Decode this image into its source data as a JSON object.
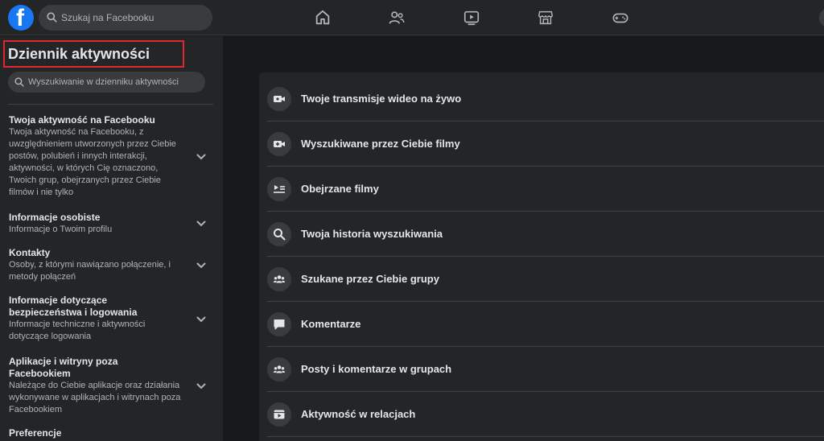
{
  "topbar": {
    "search_placeholder": "Szukaj na Facebooku",
    "nav_icons": [
      "home-icon",
      "friends-icon",
      "watch-icon",
      "marketplace-icon",
      "gaming-icon"
    ]
  },
  "sidebar": {
    "title": "Dziennik aktywności",
    "search_placeholder": "Wyszukiwanie w dzienniku aktywności",
    "items": [
      {
        "heading": "Twoja aktywność na Facebooku",
        "desc_lines": [
          "Twoja aktywność na Facebooku, z",
          "uwzględnieniem utworzonych przez Ciebie",
          "postów, polubień i innych interakcji,",
          "aktywności, w których Cię oznaczono,",
          "Twoich grup, obejrzanych przez Ciebie",
          "filmów i nie tylko"
        ]
      },
      {
        "heading": "Informacje osobiste",
        "desc_lines": [
          "Informacje o Twoim profilu"
        ]
      },
      {
        "heading": "Kontakty",
        "desc_lines": [
          "Osoby, z którymi nawiązano połączenie, i",
          "metody połączeń"
        ]
      },
      {
        "heading_lines": [
          "Informacje dotyczące",
          "bezpieczeństwa i logowania"
        ],
        "desc_lines": [
          "Informacje techniczne i aktywności",
          "dotyczące logowania"
        ]
      },
      {
        "heading_lines": [
          "Aplikacje i witryny poza",
          "Facebookiem"
        ],
        "desc_lines": [
          "Należące do Ciebie aplikacje oraz działania",
          "wykonywane w aplikacjach i witrynach poza",
          "Facebookiem"
        ]
      },
      {
        "heading": "Preferencje"
      }
    ]
  },
  "main": {
    "rows": [
      {
        "label": "Twoje transmisje wideo na żywo",
        "icon": "live-video-icon"
      },
      {
        "label": "Wyszukiwane przez Ciebie filmy",
        "icon": "video-search-icon"
      },
      {
        "label": "Obejrzane filmy",
        "icon": "watched-videos-icon"
      },
      {
        "label": "Twoja historia wyszukiwania",
        "icon": "search-icon"
      },
      {
        "label": "Szukane przez Ciebie grupy",
        "icon": "groups-icon"
      },
      {
        "label": "Komentarze",
        "icon": "comment-icon"
      },
      {
        "label": "Posty i komentarze w grupach",
        "icon": "groups-icon"
      },
      {
        "label": "Aktywność w relacjach",
        "icon": "stories-icon"
      }
    ]
  },
  "colors": {
    "background": "#18191a",
    "panel": "#242526",
    "brand": "#1877f2",
    "highlight_box": "#e0262e"
  }
}
